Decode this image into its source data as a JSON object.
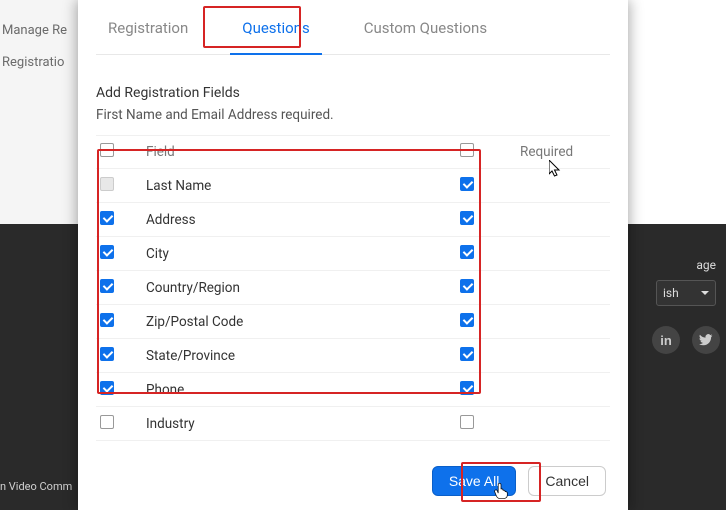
{
  "backdrop": {
    "link1": "Manage Re",
    "link2": "Registratio",
    "footer_left": "n Video Comm",
    "language_label": "age",
    "language_value": "ish"
  },
  "tabs": [
    {
      "label": "Registration",
      "active": false
    },
    {
      "label": "Questions",
      "active": true
    },
    {
      "label": "Custom Questions",
      "active": false
    }
  ],
  "section": {
    "title": "Add Registration Fields",
    "sub": "First Name and Email Address required."
  },
  "columns": {
    "field": "Field",
    "required": "Required"
  },
  "fields": [
    {
      "label": "Last Name",
      "enabled": true,
      "required": true,
      "locked": true
    },
    {
      "label": "Address",
      "enabled": true,
      "required": true,
      "locked": false
    },
    {
      "label": "City",
      "enabled": true,
      "required": true,
      "locked": false
    },
    {
      "label": "Country/Region",
      "enabled": true,
      "required": true,
      "locked": false
    },
    {
      "label": "Zip/Postal Code",
      "enabled": true,
      "required": true,
      "locked": false
    },
    {
      "label": "State/Province",
      "enabled": true,
      "required": true,
      "locked": false
    },
    {
      "label": "Phone",
      "enabled": true,
      "required": true,
      "locked": false
    },
    {
      "label": "Industry",
      "enabled": false,
      "required": false,
      "locked": false
    }
  ],
  "buttons": {
    "save": "Save All",
    "cancel": "Cancel"
  }
}
